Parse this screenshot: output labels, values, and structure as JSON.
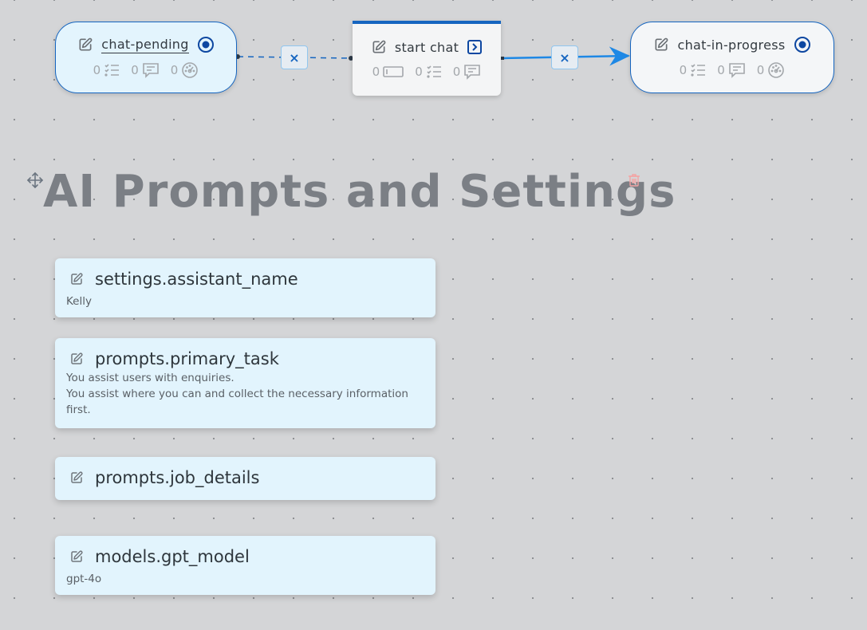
{
  "flow": {
    "nodes": [
      {
        "id": "chat-pending",
        "kind": "state",
        "title": "chat-pending",
        "selected": true,
        "stats": [
          {
            "icon": "checklist-icon",
            "count": "0"
          },
          {
            "icon": "message-icon",
            "count": "0"
          },
          {
            "icon": "gauge-icon",
            "count": "0"
          }
        ]
      },
      {
        "id": "start-chat",
        "kind": "action",
        "title": "start chat",
        "stats": [
          {
            "icon": "input-field-icon",
            "count": "0"
          },
          {
            "icon": "checklist-icon",
            "count": "0"
          },
          {
            "icon": "message-icon",
            "count": "0"
          }
        ]
      },
      {
        "id": "chat-in-progress",
        "kind": "state",
        "title": "chat-in-progress",
        "stats": [
          {
            "icon": "checklist-icon",
            "count": "0"
          },
          {
            "icon": "message-icon",
            "count": "0"
          },
          {
            "icon": "gauge-icon",
            "count": "0"
          }
        ]
      }
    ],
    "edges": [
      {
        "from": "chat-pending",
        "to": "start-chat",
        "style": "dashed",
        "delete_label": "×"
      },
      {
        "from": "start-chat",
        "to": "chat-in-progress",
        "style": "solid-arrow",
        "delete_label": "×"
      }
    ],
    "accent_color": "#1565c0",
    "edge_color": "#1e88e5"
  },
  "section": {
    "title": "AI Prompts and Settings"
  },
  "variables": [
    {
      "name": "settings.assistant_name",
      "value": "Kelly"
    },
    {
      "name": "prompts.primary_task",
      "value": "You assist users with enquiries.\nYou assist where you can and collect the necessary information first."
    },
    {
      "name": "prompts.job_details",
      "value": ""
    },
    {
      "name": "models.gpt_model",
      "value": "gpt-4o"
    }
  ]
}
